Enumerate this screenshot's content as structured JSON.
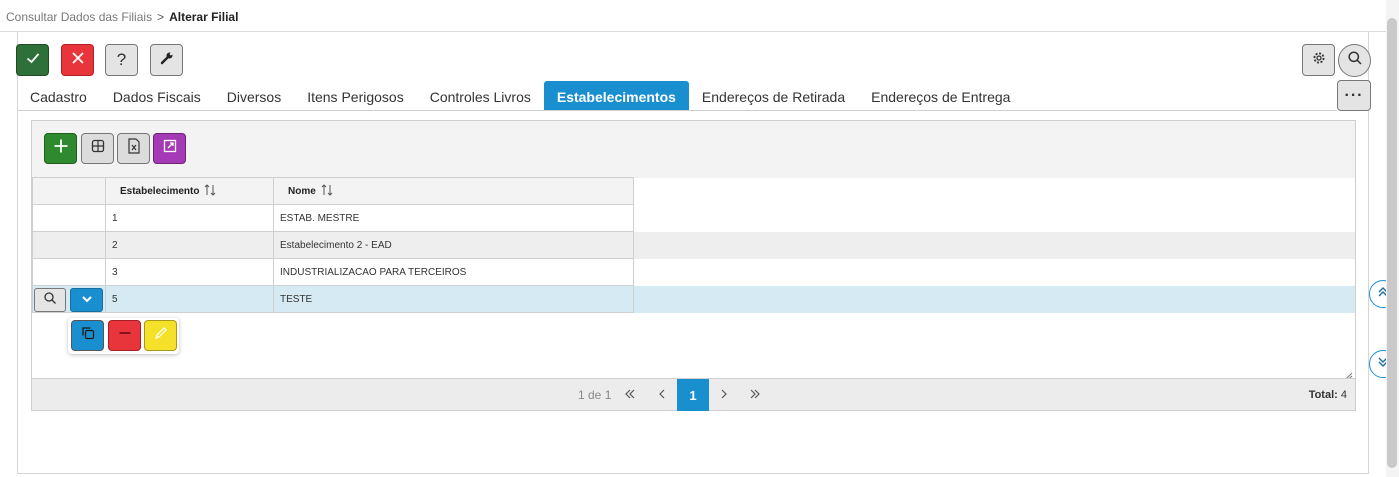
{
  "breadcrumb": {
    "parent": "Consultar Dados das Filiais",
    "separator": ">",
    "current": "Alterar Filial"
  },
  "toolbar": {
    "confirm": {
      "icon": "check-icon",
      "color": "#2f6f3a"
    },
    "cancel": {
      "icon": "close-icon",
      "color": "#e8353b"
    },
    "help": {
      "icon": "question-icon",
      "label": "?"
    },
    "tools": {
      "icon": "wrench-icon"
    },
    "settings": {
      "icon": "gear-icon"
    },
    "search": {
      "icon": "search-icon"
    }
  },
  "tabs": [
    {
      "label": "Cadastro",
      "active": false
    },
    {
      "label": "Dados Fiscais",
      "active": false
    },
    {
      "label": "Diversos",
      "active": false
    },
    {
      "label": "Itens Perigosos",
      "active": false
    },
    {
      "label": "Controles Livros",
      "active": false
    },
    {
      "label": "Estabelecimentos",
      "active": true
    },
    {
      "label": "Endereços de Retirada",
      "active": false
    },
    {
      "label": "Endereços de Entrega",
      "active": false
    }
  ],
  "more_button": {
    "label": "···"
  },
  "grid": {
    "toolbar": {
      "add": {
        "icon": "plus-icon",
        "color": "#2f8a2f"
      },
      "columns": {
        "icon": "table-columns-icon"
      },
      "excel": {
        "icon": "excel-export-icon"
      },
      "expand": {
        "icon": "expand-icon",
        "color": "#a43ab5"
      }
    },
    "columns": [
      {
        "label": "Estabelecimento",
        "sortable": true
      },
      {
        "label": "Nome",
        "sortable": true
      }
    ],
    "rows": [
      {
        "estabelecimento": "1",
        "nome": "ESTAB. MESTRE"
      },
      {
        "estabelecimento": "2",
        "nome": "Estabelecimento 2 - EAD"
      },
      {
        "estabelecimento": "3",
        "nome": "INDUSTRIALIZACAO PARA TERCEIROS"
      },
      {
        "estabelecimento": "5",
        "nome": "TESTE",
        "selected": true
      }
    ],
    "row_actions": {
      "copy": {
        "icon": "copy-icon",
        "color": "#1a8fcf"
      },
      "delete": {
        "icon": "minus-icon",
        "color": "#e8353b"
      },
      "edit": {
        "icon": "pencil-icon",
        "color": "#f5e12a"
      }
    },
    "pagination": {
      "info": "1 de 1",
      "current_page": "1",
      "total_label": "Total:",
      "total_value": "4"
    }
  },
  "side_nav": {
    "up": "double-chevron-up-icon",
    "down": "double-chevron-down-icon"
  },
  "colors": {
    "accent": "#1a8fcf",
    "selected_row": "#d5eaf2"
  }
}
